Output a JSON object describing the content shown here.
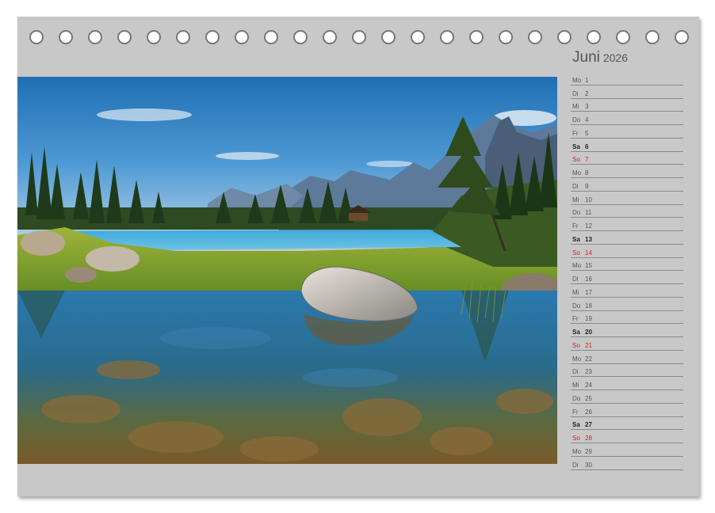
{
  "calendar": {
    "month": "Juni",
    "year": "2026",
    "ring_count": 23,
    "colors": {
      "page": "#c8c8c8",
      "sunday": "#d42020",
      "weekday": "#555555",
      "saturday": "#222222"
    },
    "photo": {
      "kind": "landscape photograph",
      "subject": "alpine lake with rocks, reeds, forest and mountains"
    },
    "days": [
      {
        "wd": "Mo",
        "d": "1",
        "type": "weekday"
      },
      {
        "wd": "Di",
        "d": "2",
        "type": "weekday"
      },
      {
        "wd": "Mi",
        "d": "3",
        "type": "weekday"
      },
      {
        "wd": "Do",
        "d": "4",
        "type": "weekday"
      },
      {
        "wd": "Fr",
        "d": "5",
        "type": "weekday"
      },
      {
        "wd": "Sa",
        "d": "6",
        "type": "saturday"
      },
      {
        "wd": "So",
        "d": "7",
        "type": "sunday"
      },
      {
        "wd": "Mo",
        "d": "8",
        "type": "weekday"
      },
      {
        "wd": "Di",
        "d": "9",
        "type": "weekday"
      },
      {
        "wd": "Mi",
        "d": "10",
        "type": "weekday"
      },
      {
        "wd": "Do",
        "d": "11",
        "type": "weekday"
      },
      {
        "wd": "Fr",
        "d": "12",
        "type": "weekday"
      },
      {
        "wd": "Sa",
        "d": "13",
        "type": "saturday"
      },
      {
        "wd": "So",
        "d": "14",
        "type": "sunday"
      },
      {
        "wd": "Mo",
        "d": "15",
        "type": "weekday"
      },
      {
        "wd": "Di",
        "d": "16",
        "type": "weekday"
      },
      {
        "wd": "Mi",
        "d": "17",
        "type": "weekday"
      },
      {
        "wd": "Do",
        "d": "18",
        "type": "weekday"
      },
      {
        "wd": "Fr",
        "d": "19",
        "type": "weekday"
      },
      {
        "wd": "Sa",
        "d": "20",
        "type": "saturday"
      },
      {
        "wd": "So",
        "d": "21",
        "type": "sunday"
      },
      {
        "wd": "Mo",
        "d": "22",
        "type": "weekday"
      },
      {
        "wd": "Di",
        "d": "23",
        "type": "weekday"
      },
      {
        "wd": "Mi",
        "d": "24",
        "type": "weekday"
      },
      {
        "wd": "Do",
        "d": "25",
        "type": "weekday"
      },
      {
        "wd": "Fr",
        "d": "26",
        "type": "weekday"
      },
      {
        "wd": "Sa",
        "d": "27",
        "type": "saturday"
      },
      {
        "wd": "So",
        "d": "28",
        "type": "sunday"
      },
      {
        "wd": "Mo",
        "d": "29",
        "type": "weekday"
      },
      {
        "wd": "Di",
        "d": "30",
        "type": "weekday"
      }
    ]
  }
}
